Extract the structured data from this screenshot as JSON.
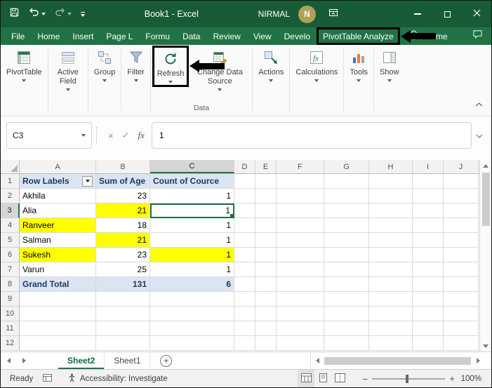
{
  "window": {
    "title": "Book1 - Excel",
    "user_name": "NIRMAL",
    "avatar_initial": "N"
  },
  "tabs": {
    "items": [
      {
        "label": "File"
      },
      {
        "label": "Home"
      },
      {
        "label": "Insert"
      },
      {
        "label": "Page L"
      },
      {
        "label": "Formu"
      },
      {
        "label": "Data"
      },
      {
        "label": "Review"
      },
      {
        "label": "View"
      },
      {
        "label": "Develo"
      },
      {
        "label": "PivotTable Analyze",
        "annotated": true
      }
    ],
    "tell_me": "Tell me"
  },
  "ribbon": {
    "groups": [
      {
        "buttons": [
          {
            "label": "PivotTable",
            "icon": "pivottable"
          }
        ]
      },
      {
        "buttons": [
          {
            "label": "Active Field",
            "icon": "active-field"
          }
        ]
      },
      {
        "buttons": [
          {
            "label": "Group",
            "icon": "group"
          }
        ]
      },
      {
        "buttons": [
          {
            "label": "Filter",
            "icon": "filter"
          }
        ]
      },
      {
        "label": "Data",
        "buttons": [
          {
            "label": "Refresh",
            "icon": "refresh",
            "annotated": true
          },
          {
            "label": "Change Data Source",
            "icon": "change-data-source"
          }
        ]
      },
      {
        "buttons": [
          {
            "label": "Actions",
            "icon": "actions"
          }
        ]
      },
      {
        "buttons": [
          {
            "label": "Calculations",
            "icon": "calculations"
          }
        ]
      },
      {
        "buttons": [
          {
            "label": "Tools",
            "icon": "tools"
          }
        ]
      },
      {
        "buttons": [
          {
            "label": "Show",
            "icon": "show"
          }
        ]
      }
    ]
  },
  "formula_bar": {
    "name_box": "C3",
    "fx_label": "fx",
    "value": "1"
  },
  "grid": {
    "columns": [
      "A",
      "B",
      "C",
      "D",
      "E",
      "F",
      "G",
      "H",
      "I",
      "J"
    ],
    "selected_column": "C",
    "selected_row": 3,
    "selected_cell": "C3",
    "rows": [
      {
        "num": 1,
        "cells": [
          {
            "col": "A",
            "text": "Row Labels",
            "cls": "hdr",
            "filter": true
          },
          {
            "col": "B",
            "text": "Sum of Age",
            "cls": "hdr"
          },
          {
            "col": "C",
            "text": "Count of Cource",
            "cls": "hdr"
          }
        ]
      },
      {
        "num": 2,
        "cells": [
          {
            "col": "A",
            "text": "Akhila"
          },
          {
            "col": "B",
            "text": "23",
            "cls": "num"
          },
          {
            "col": "C",
            "text": "1",
            "cls": "num"
          }
        ]
      },
      {
        "num": 3,
        "cells": [
          {
            "col": "A",
            "text": "Alia"
          },
          {
            "col": "B",
            "text": "21",
            "cls": "num yellow"
          },
          {
            "col": "C",
            "text": "1",
            "cls": "num selected"
          }
        ]
      },
      {
        "num": 4,
        "cells": [
          {
            "col": "A",
            "text": "Ranveer",
            "cls": "yellow"
          },
          {
            "col": "B",
            "text": "18",
            "cls": "num"
          },
          {
            "col": "C",
            "text": "1",
            "cls": "num"
          }
        ]
      },
      {
        "num": 5,
        "cells": [
          {
            "col": "A",
            "text": "Salman"
          },
          {
            "col": "B",
            "text": "21",
            "cls": "num yellow"
          },
          {
            "col": "C",
            "text": "1",
            "cls": "num"
          }
        ]
      },
      {
        "num": 6,
        "cells": [
          {
            "col": "A",
            "text": "Sukesh",
            "cls": "yellow"
          },
          {
            "col": "B",
            "text": "23",
            "cls": "num"
          },
          {
            "col": "C",
            "text": "1",
            "cls": "num yellow"
          }
        ]
      },
      {
        "num": 7,
        "cells": [
          {
            "col": "A",
            "text": "Varun"
          },
          {
            "col": "B",
            "text": "25",
            "cls": "num"
          },
          {
            "col": "C",
            "text": "1",
            "cls": "num"
          }
        ]
      },
      {
        "num": 8,
        "cells": [
          {
            "col": "A",
            "text": "Grand Total",
            "cls": "total"
          },
          {
            "col": "B",
            "text": "131",
            "cls": "total num"
          },
          {
            "col": "C",
            "text": "6",
            "cls": "total num"
          }
        ]
      },
      {
        "num": 9,
        "cells": []
      },
      {
        "num": 10,
        "cells": []
      },
      {
        "num": 11,
        "cells": []
      },
      {
        "num": 12,
        "cells": []
      }
    ]
  },
  "sheet_tabs": [
    {
      "label": "Sheet2",
      "active": true
    },
    {
      "label": "Sheet1",
      "active": false
    }
  ],
  "status_bar": {
    "mode": "Ready",
    "accessibility": "Accessibility: Investigate",
    "zoom": "100%"
  },
  "icons": {
    "new_sheet": "+",
    "formula_cancel": "×",
    "formula_enter": "✓",
    "zoom_out": "−",
    "zoom_in": "+"
  },
  "colors": {
    "title_bar_green": "#185c37",
    "excel_green": "#217346",
    "highlight_yellow": "#ffff00",
    "pivot_header_bg": "#dbe5f1",
    "pivot_header_text": "#1f3864",
    "annotation_black": "#000000"
  }
}
